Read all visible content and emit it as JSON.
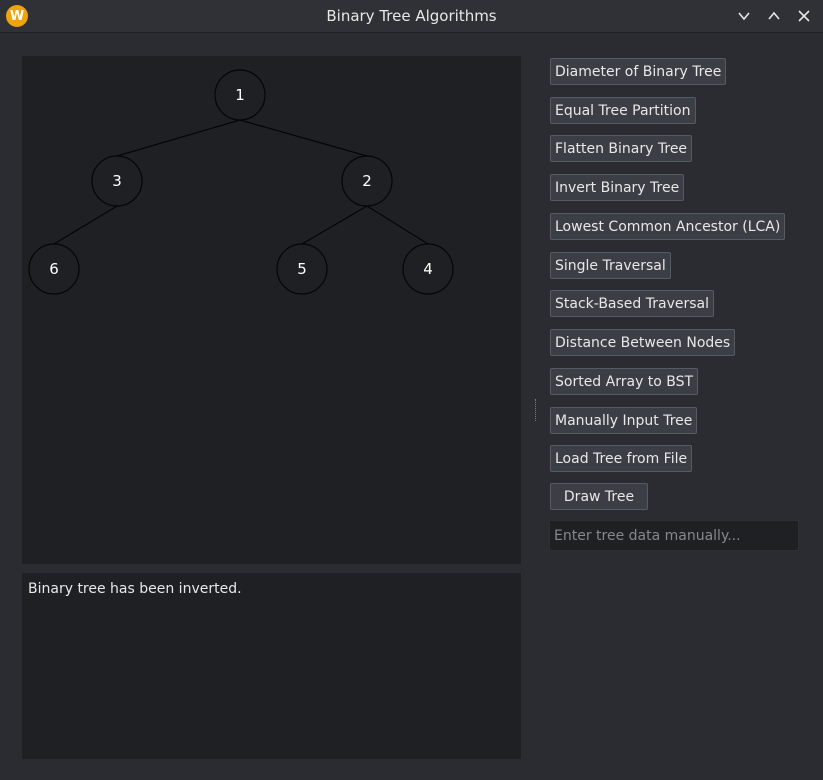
{
  "window": {
    "title": "Binary Tree Algorithms",
    "logo_letter": "W",
    "logo_color": "#f0a30a"
  },
  "tree": {
    "nodes": [
      {
        "id": "n1",
        "label": "1",
        "parent": null
      },
      {
        "id": "n3",
        "label": "3",
        "parent": "n1"
      },
      {
        "id": "n2",
        "label": "2",
        "parent": "n1"
      },
      {
        "id": "n6",
        "label": "6",
        "parent": "n3"
      },
      {
        "id": "n5",
        "label": "5",
        "parent": "n2"
      },
      {
        "id": "n4",
        "label": "4",
        "parent": "n2"
      }
    ]
  },
  "output": {
    "message": "Binary tree has been inverted."
  },
  "buttons": {
    "diameter": "Diameter of Binary Tree",
    "equal_partition": "Equal Tree Partition",
    "flatten": "Flatten Binary Tree",
    "invert": "Invert Binary Tree",
    "lca": "Lowest Common Ancestor (LCA)",
    "single_traversal": "Single Traversal",
    "stack_traversal": "Stack-Based Traversal",
    "distance": "Distance Between Nodes",
    "sorted_to_bst": "Sorted Array to BST",
    "manual_input": "Manually Input Tree",
    "load_file": "Load Tree from File",
    "draw": "Draw Tree"
  },
  "tree_input": {
    "placeholder": "Enter tree data manually..."
  }
}
